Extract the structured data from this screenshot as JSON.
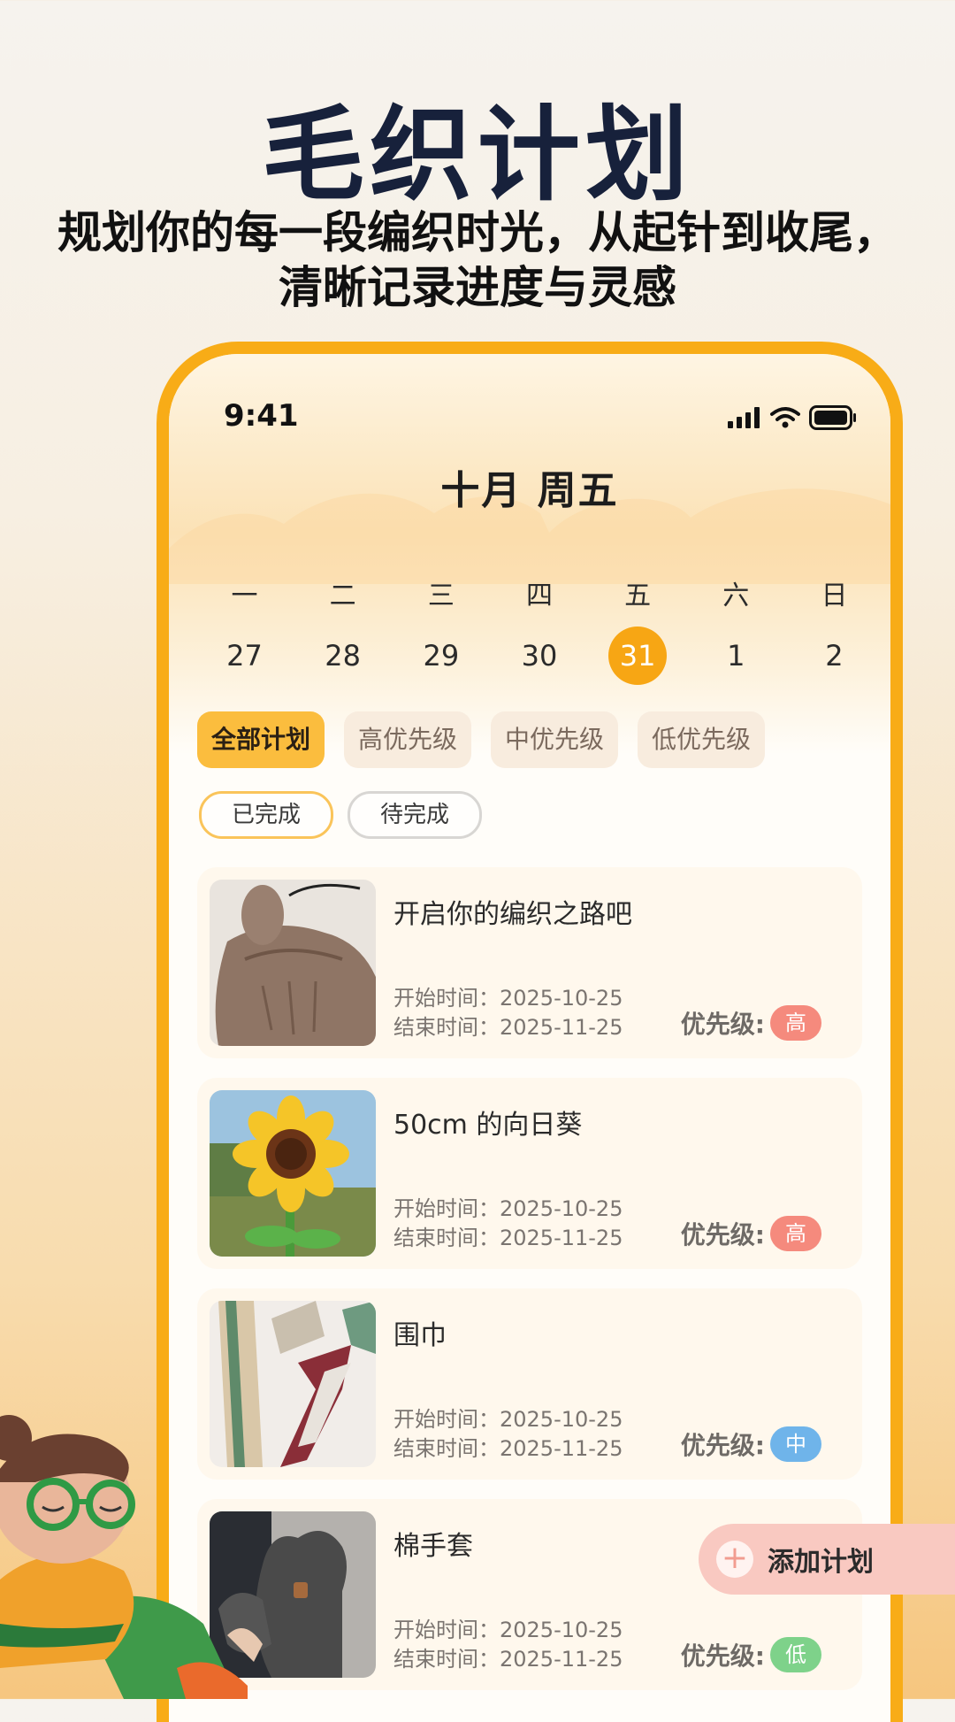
{
  "promo": {
    "title": "毛织计划",
    "subtitle": "规划你的每一段编织时光，从起针到收尾，清晰记录进度与灵感"
  },
  "status_bar": {
    "time": "9:41"
  },
  "header": {
    "title": "十月  周五"
  },
  "calendar": {
    "days": [
      {
        "weekday": "一",
        "date": "27"
      },
      {
        "weekday": "二",
        "date": "28"
      },
      {
        "weekday": "三",
        "date": "29"
      },
      {
        "weekday": "四",
        "date": "30"
      },
      {
        "weekday": "五",
        "date": "31",
        "selected": true
      },
      {
        "weekday": "六",
        "date": "1"
      },
      {
        "weekday": "日",
        "date": "2"
      }
    ]
  },
  "filters": {
    "priority": [
      "全部计划",
      "高优先级",
      "中优先级",
      "低优先级"
    ],
    "active_priority": "全部计划",
    "completion": [
      "已完成",
      "待完成"
    ],
    "active_completion": "已完成"
  },
  "plans": [
    {
      "title": "开启你的编织之路吧",
      "start": "开始时间：2025-10-25",
      "end": "结束时间：2025-11-25",
      "priority_label": "优先级:",
      "priority": "高",
      "priority_color": "#f58a7d",
      "image": "brown-knit-sweater-with-yarn-cone"
    },
    {
      "title": "50cm 的向日葵",
      "start": "开始时间：2025-10-25",
      "end": "结束时间：2025-11-25",
      "priority_label": "优先级:",
      "priority": "高",
      "priority_color": "#f58a7d",
      "image": "crochet-sunflower"
    },
    {
      "title": "围巾",
      "start": "开始时间：2025-10-25",
      "end": "结束时间：2025-11-25",
      "priority_label": "优先级:",
      "priority": "中",
      "priority_color": "#6fb4ea",
      "image": "knitted-scarves"
    },
    {
      "title": "棉手套",
      "start": "开始时间：2025-10-25",
      "end": "结束时间：2025-11-25",
      "priority_label": "优先级:",
      "priority": "低",
      "priority_color": "#7ed28a",
      "image": "grey-knit-gloves"
    }
  ],
  "fab": {
    "label": "添加计划",
    "icon": "plus-icon"
  },
  "colors": {
    "accent": "#f8ac17",
    "title": "#17213b"
  }
}
